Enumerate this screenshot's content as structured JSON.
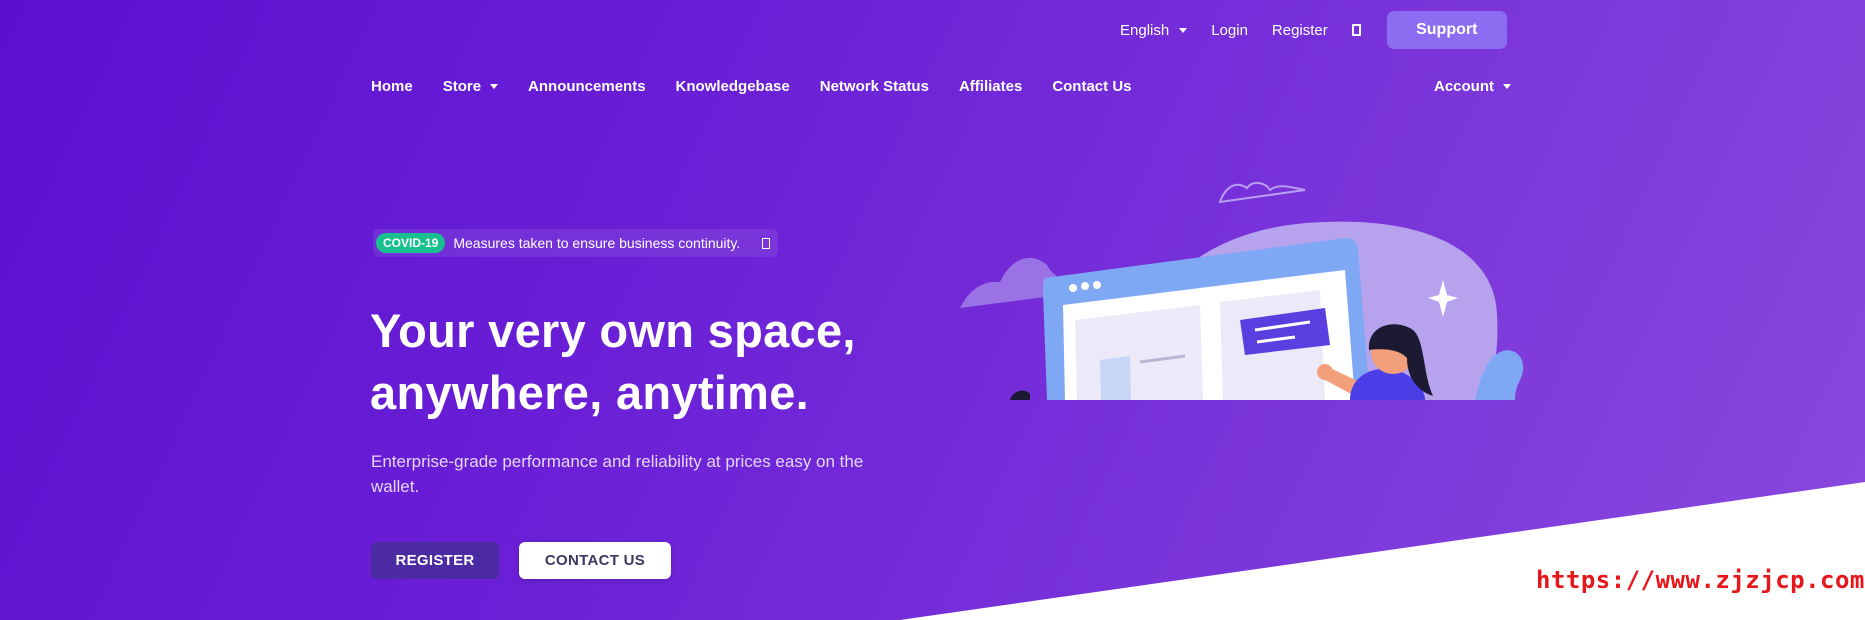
{
  "topbar": {
    "language": "English",
    "login": "Login",
    "register": "Register",
    "cart_icon": "cart-icon",
    "support": "Support"
  },
  "nav": {
    "items": [
      {
        "label": "Home"
      },
      {
        "label": "Store",
        "dropdown": true
      },
      {
        "label": "Announcements"
      },
      {
        "label": "Knowledgebase"
      },
      {
        "label": "Network Status"
      },
      {
        "label": "Affiliates"
      },
      {
        "label": "Contact Us"
      }
    ],
    "account": "Account"
  },
  "covid": {
    "tag": "COVID-19",
    "message": "Measures taken to ensure business continuity."
  },
  "hero": {
    "title_line1": "Your very own space,",
    "title_line2": "anywhere, anytime.",
    "subtitle": "Enterprise-grade performance and reliability at prices easy on the wallet.",
    "register_button": "REGISTER",
    "contact_button": "CONTACT US"
  },
  "watermark": "https://www.zjzjcp.com",
  "colors": {
    "bg_start": "#5b10cf",
    "bg_end": "#8a49de",
    "support_button": "#8c6df1",
    "register_button": "#4b2aa2",
    "covid_tag": "#18c08f",
    "watermark": "#e5171b"
  }
}
